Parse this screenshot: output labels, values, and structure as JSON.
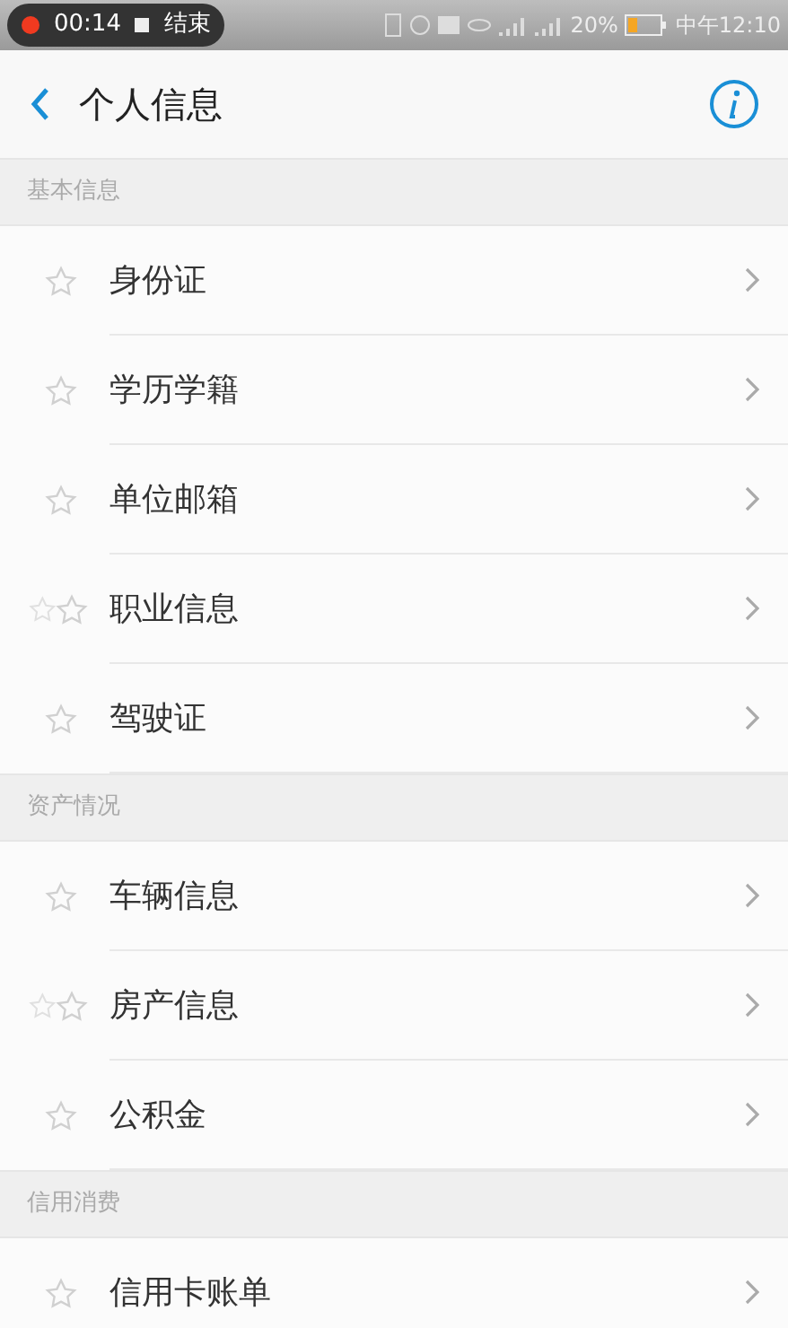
{
  "status_bar": {
    "recording_time": "00:14",
    "stop_label": "结束",
    "battery": "20%",
    "time": "中午12:10"
  },
  "header": {
    "title": "个人信息"
  },
  "sections": [
    {
      "title": "基本信息",
      "items": [
        {
          "label": "身份证",
          "kind": "single"
        },
        {
          "label": "学历学籍",
          "kind": "single"
        },
        {
          "label": "单位邮箱",
          "kind": "single"
        },
        {
          "label": "职业信息",
          "kind": "double"
        },
        {
          "label": "驾驶证",
          "kind": "single"
        }
      ]
    },
    {
      "title": "资产情况",
      "items": [
        {
          "label": "车辆信息",
          "kind": "single"
        },
        {
          "label": "房产信息",
          "kind": "double"
        },
        {
          "label": "公积金",
          "kind": "single"
        }
      ]
    },
    {
      "title": "信用消费",
      "items": [
        {
          "label": "信用卡账单",
          "kind": "single"
        }
      ]
    }
  ]
}
